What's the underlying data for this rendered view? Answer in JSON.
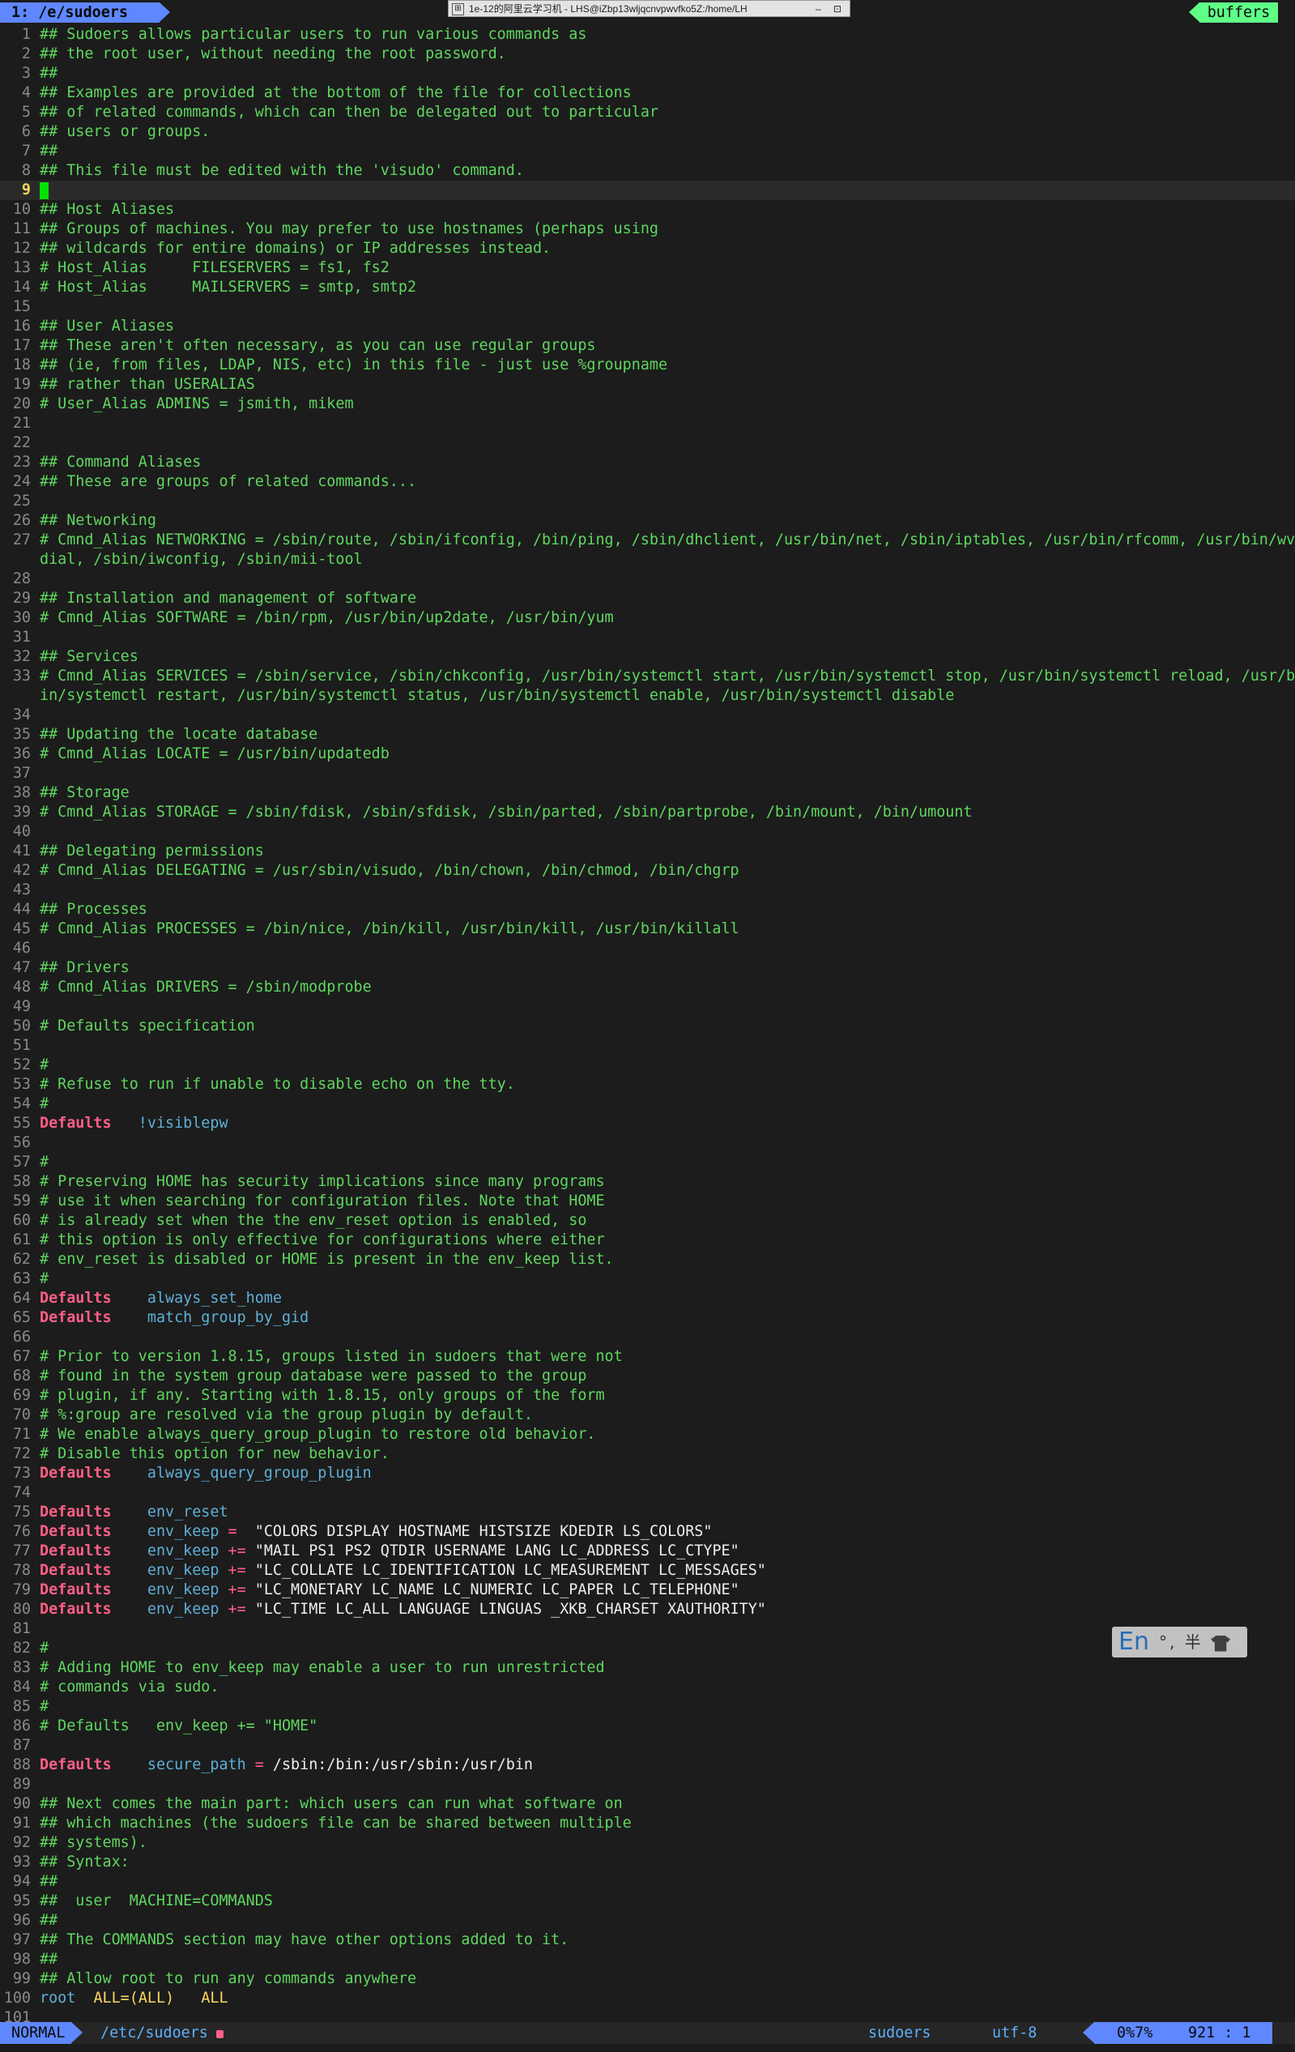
{
  "tabline": {
    "active_tab": "1: /e/sudoers",
    "buffers_label": "buffers"
  },
  "window_title": {
    "text": "1e-12的阿里云学习机 - LHS@iZbp13wljqcnvpwvfko5Z:/home/LH",
    "controls": "– ⊡"
  },
  "cursor_line": 9,
  "lines": [
    [
      {
        "c": "comment",
        "t": "## Sudoers allows particular users to run various commands as"
      }
    ],
    [
      {
        "c": "comment",
        "t": "## the root user, without needing the root password."
      }
    ],
    [
      {
        "c": "comment",
        "t": "##"
      }
    ],
    [
      {
        "c": "comment",
        "t": "## Examples are provided at the bottom of the file for collections"
      }
    ],
    [
      {
        "c": "comment",
        "t": "## of related commands, which can then be delegated out to particular"
      }
    ],
    [
      {
        "c": "comment",
        "t": "## users or groups."
      }
    ],
    [
      {
        "c": "comment",
        "t": "##"
      }
    ],
    [
      {
        "c": "comment",
        "t": "## This file must be edited with the 'visudo' command."
      }
    ],
    [],
    [
      {
        "c": "comment",
        "t": "## Host Aliases"
      }
    ],
    [
      {
        "c": "comment",
        "t": "## Groups of machines. You may prefer to use hostnames (perhaps using"
      }
    ],
    [
      {
        "c": "comment",
        "t": "## wildcards for entire domains) or IP addresses instead."
      }
    ],
    [
      {
        "c": "comment",
        "t": "# Host_Alias     FILESERVERS = fs1, fs2"
      }
    ],
    [
      {
        "c": "comment",
        "t": "# Host_Alias     MAILSERVERS = smtp, smtp2"
      }
    ],
    [],
    [
      {
        "c": "comment",
        "t": "## User Aliases"
      }
    ],
    [
      {
        "c": "comment",
        "t": "## These aren't often necessary, as you can use regular groups"
      }
    ],
    [
      {
        "c": "comment",
        "t": "## (ie, from files, LDAP, NIS, etc) in this file - just use %groupname"
      }
    ],
    [
      {
        "c": "comment",
        "t": "## rather than USERALIAS"
      }
    ],
    [
      {
        "c": "comment",
        "t": "# User_Alias ADMINS = jsmith, mikem"
      }
    ],
    [],
    [],
    [
      {
        "c": "comment",
        "t": "## Command Aliases"
      }
    ],
    [
      {
        "c": "comment",
        "t": "## These are groups of related commands..."
      }
    ],
    [],
    [
      {
        "c": "comment",
        "t": "## Networking"
      }
    ],
    [
      {
        "c": "comment",
        "t": "# Cmnd_Alias NETWORKING = /sbin/route, /sbin/ifconfig, /bin/ping, /sbin/dhclient, /usr/bin/net, /sbin/iptables, /usr/bin/rfcomm, /usr/bin/wv"
      }
    ],
    [
      {
        "c": "comment",
        "t": "dial, /sbin/iwconfig, /sbin/mii-tool"
      }
    ],
    [],
    [
      {
        "c": "comment",
        "t": "## Installation and management of software"
      }
    ],
    [
      {
        "c": "comment",
        "t": "# Cmnd_Alias SOFTWARE = /bin/rpm, /usr/bin/up2date, /usr/bin/yum"
      }
    ],
    [],
    [
      {
        "c": "comment",
        "t": "## Services"
      }
    ],
    [
      {
        "c": "comment",
        "t": "# Cmnd_Alias SERVICES = /sbin/service, /sbin/chkconfig, /usr/bin/systemctl start, /usr/bin/systemctl stop, /usr/bin/systemctl reload, /usr/b"
      }
    ],
    [
      {
        "c": "comment",
        "t": "in/systemctl restart, /usr/bin/systemctl status, /usr/bin/systemctl enable, /usr/bin/systemctl disable"
      }
    ],
    [],
    [
      {
        "c": "comment",
        "t": "## Updating the locate database"
      }
    ],
    [
      {
        "c": "comment",
        "t": "# Cmnd_Alias LOCATE = /usr/bin/updatedb"
      }
    ],
    [],
    [
      {
        "c": "comment",
        "t": "## Storage"
      }
    ],
    [
      {
        "c": "comment",
        "t": "# Cmnd_Alias STORAGE = /sbin/fdisk, /sbin/sfdisk, /sbin/parted, /sbin/partprobe, /bin/mount, /bin/umount"
      }
    ],
    [],
    [
      {
        "c": "comment",
        "t": "## Delegating permissions"
      }
    ],
    [
      {
        "c": "comment",
        "t": "# Cmnd_Alias DELEGATING = /usr/sbin/visudo, /bin/chown, /bin/chmod, /bin/chgrp"
      }
    ],
    [],
    [
      {
        "c": "comment",
        "t": "## Processes"
      }
    ],
    [
      {
        "c": "comment",
        "t": "# Cmnd_Alias PROCESSES = /bin/nice, /bin/kill, /usr/bin/kill, /usr/bin/killall"
      }
    ],
    [],
    [
      {
        "c": "comment",
        "t": "## Drivers"
      }
    ],
    [
      {
        "c": "comment",
        "t": "# Cmnd_Alias DRIVERS = /sbin/modprobe"
      }
    ],
    [],
    [
      {
        "c": "comment",
        "t": "# Defaults specification"
      }
    ],
    [],
    [
      {
        "c": "comment",
        "t": "#"
      }
    ],
    [
      {
        "c": "comment",
        "t": "# Refuse to run if unable to disable echo on the tty."
      }
    ],
    [
      {
        "c": "comment",
        "t": "#"
      }
    ],
    [
      {
        "c": "kw",
        "t": "Defaults"
      },
      {
        "c": "plain",
        "t": "   "
      },
      {
        "c": "ident",
        "t": "!visiblepw"
      }
    ],
    [],
    [
      {
        "c": "comment",
        "t": "#"
      }
    ],
    [
      {
        "c": "comment",
        "t": "# Preserving HOME has security implications since many programs"
      }
    ],
    [
      {
        "c": "comment",
        "t": "# use it when searching for configuration files. Note that HOME"
      }
    ],
    [
      {
        "c": "comment",
        "t": "# is already set when the the env_reset option is enabled, so"
      }
    ],
    [
      {
        "c": "comment",
        "t": "# this option is only effective for configurations where either"
      }
    ],
    [
      {
        "c": "comment",
        "t": "# env_reset is disabled or HOME is present in the env_keep list."
      }
    ],
    [
      {
        "c": "comment",
        "t": "#"
      }
    ],
    [
      {
        "c": "kw",
        "t": "Defaults"
      },
      {
        "c": "plain",
        "t": "    "
      },
      {
        "c": "ident",
        "t": "always_set_home"
      }
    ],
    [
      {
        "c": "kw",
        "t": "Defaults"
      },
      {
        "c": "plain",
        "t": "    "
      },
      {
        "c": "ident",
        "t": "match_group_by_gid"
      }
    ],
    [],
    [
      {
        "c": "comment",
        "t": "# Prior to version 1.8.15, groups listed in sudoers that were not"
      }
    ],
    [
      {
        "c": "comment",
        "t": "# found in the system group database were passed to the group"
      }
    ],
    [
      {
        "c": "comment",
        "t": "# plugin, if any. Starting with 1.8.15, only groups of the form"
      }
    ],
    [
      {
        "c": "comment",
        "t": "# %:group are resolved via the group plugin by default."
      }
    ],
    [
      {
        "c": "comment",
        "t": "# We enable always_query_group_plugin to restore old behavior."
      }
    ],
    [
      {
        "c": "comment",
        "t": "# Disable this option for new behavior."
      }
    ],
    [
      {
        "c": "kw",
        "t": "Defaults"
      },
      {
        "c": "plain",
        "t": "    "
      },
      {
        "c": "ident",
        "t": "always_query_group_plugin"
      }
    ],
    [],
    [
      {
        "c": "kw",
        "t": "Defaults"
      },
      {
        "c": "plain",
        "t": "    "
      },
      {
        "c": "ident",
        "t": "env_reset"
      }
    ],
    [
      {
        "c": "kw",
        "t": "Defaults"
      },
      {
        "c": "plain",
        "t": "    "
      },
      {
        "c": "ident",
        "t": "env_keep"
      },
      {
        "c": "plain",
        "t": " "
      },
      {
        "c": "op",
        "t": "="
      },
      {
        "c": "plain",
        "t": "  "
      },
      {
        "c": "str",
        "t": "\"COLORS DISPLAY HOSTNAME HISTSIZE KDEDIR LS_COLORS\""
      }
    ],
    [
      {
        "c": "kw",
        "t": "Defaults"
      },
      {
        "c": "plain",
        "t": "    "
      },
      {
        "c": "ident",
        "t": "env_keep"
      },
      {
        "c": "plain",
        "t": " "
      },
      {
        "c": "op",
        "t": "+="
      },
      {
        "c": "plain",
        "t": " "
      },
      {
        "c": "str",
        "t": "\"MAIL PS1 PS2 QTDIR USERNAME LANG LC_ADDRESS LC_CTYPE\""
      }
    ],
    [
      {
        "c": "kw",
        "t": "Defaults"
      },
      {
        "c": "plain",
        "t": "    "
      },
      {
        "c": "ident",
        "t": "env_keep"
      },
      {
        "c": "plain",
        "t": " "
      },
      {
        "c": "op",
        "t": "+="
      },
      {
        "c": "plain",
        "t": " "
      },
      {
        "c": "str",
        "t": "\"LC_COLLATE LC_IDENTIFICATION LC_MEASUREMENT LC_MESSAGES\""
      }
    ],
    [
      {
        "c": "kw",
        "t": "Defaults"
      },
      {
        "c": "plain",
        "t": "    "
      },
      {
        "c": "ident",
        "t": "env_keep"
      },
      {
        "c": "plain",
        "t": " "
      },
      {
        "c": "op",
        "t": "+="
      },
      {
        "c": "plain",
        "t": " "
      },
      {
        "c": "str",
        "t": "\"LC_MONETARY LC_NAME LC_NUMERIC LC_PAPER LC_TELEPHONE\""
      }
    ],
    [
      {
        "c": "kw",
        "t": "Defaults"
      },
      {
        "c": "plain",
        "t": "    "
      },
      {
        "c": "ident",
        "t": "env_keep"
      },
      {
        "c": "plain",
        "t": " "
      },
      {
        "c": "op",
        "t": "+="
      },
      {
        "c": "plain",
        "t": " "
      },
      {
        "c": "str",
        "t": "\"LC_TIME LC_ALL LANGUAGE LINGUAS _XKB_CHARSET XAUTHORITY\""
      }
    ],
    [],
    [
      {
        "c": "comment",
        "t": "#"
      }
    ],
    [
      {
        "c": "comment",
        "t": "# Adding HOME to env_keep may enable a user to run unrestricted"
      }
    ],
    [
      {
        "c": "comment",
        "t": "# commands via sudo."
      }
    ],
    [
      {
        "c": "comment",
        "t": "#"
      }
    ],
    [
      {
        "c": "comment",
        "t": "# Defaults   env_keep += \"HOME\""
      }
    ],
    [],
    [
      {
        "c": "kw",
        "t": "Defaults"
      },
      {
        "c": "plain",
        "t": "    "
      },
      {
        "c": "ident",
        "t": "secure_path"
      },
      {
        "c": "plain",
        "t": " "
      },
      {
        "c": "op",
        "t": "="
      },
      {
        "c": "plain",
        "t": " "
      },
      {
        "c": "str",
        "t": "/sbin:/bin:/usr/sbin:/usr/bin"
      }
    ],
    [],
    [
      {
        "c": "comment",
        "t": "## Next comes the main part: which users can run what software on"
      }
    ],
    [
      {
        "c": "comment",
        "t": "## which machines (the sudoers file can be shared between multiple"
      }
    ],
    [
      {
        "c": "comment",
        "t": "## systems)."
      }
    ],
    [
      {
        "c": "comment",
        "t": "## Syntax:"
      }
    ],
    [
      {
        "c": "comment",
        "t": "##"
      }
    ],
    [
      {
        "c": "comment",
        "t": "##  user  MACHINE=COMMANDS"
      }
    ],
    [
      {
        "c": "comment",
        "t": "##"
      }
    ],
    [
      {
        "c": "comment",
        "t": "## The COMMANDS section may have other options added to it."
      }
    ],
    [
      {
        "c": "comment",
        "t": "##"
      }
    ],
    [
      {
        "c": "comment",
        "t": "## Allow root to run any commands anywhere"
      }
    ],
    [
      {
        "c": "user",
        "t": "root"
      },
      {
        "c": "plain",
        "t": "  "
      },
      {
        "c": "val",
        "t": "ALL=(ALL)"
      },
      {
        "c": "plain",
        "t": "   "
      },
      {
        "c": "val",
        "t": "ALL"
      }
    ],
    []
  ],
  "line_numbers": [
    "1",
    "2",
    "3",
    "4",
    "5",
    "6",
    "7",
    "8",
    "9",
    "10",
    "11",
    "12",
    "13",
    "14",
    "15",
    "16",
    "17",
    "18",
    "19",
    "20",
    "21",
    "22",
    "23",
    "24",
    "25",
    "26",
    "27",
    "",
    "28",
    "29",
    "30",
    "31",
    "32",
    "33",
    "",
    "34",
    "35",
    "36",
    "37",
    "38",
    "39",
    "40",
    "41",
    "42",
    "43",
    "44",
    "45",
    "46",
    "47",
    "48",
    "49",
    "50",
    "51",
    "52",
    "53",
    "54",
    "55",
    "56",
    "57",
    "58",
    "59",
    "60",
    "61",
    "62",
    "63",
    "64",
    "65",
    "66",
    "67",
    "68",
    "69",
    "70",
    "71",
    "72",
    "73",
    "74",
    "75",
    "76",
    "77",
    "78",
    "79",
    "80",
    "81",
    "82",
    "83",
    "84",
    "85",
    "86",
    "87",
    "88",
    "89",
    "90",
    "91",
    "92",
    "93",
    "94",
    "95",
    "96",
    "97",
    "98",
    "99",
    "100",
    "101"
  ],
  "statusline": {
    "mode": "NORMAL",
    "path": "/etc/sudoers",
    "filetype": "sudoers",
    "encoding": "utf-8",
    "percent": "0%7%",
    "position": "921 :  1"
  },
  "ime": {
    "lang": "En",
    "rest": "°, 半"
  },
  "colors": {
    "background": "#1c1c1c",
    "comment": "#5fd75f",
    "keyword": "#ff5f87",
    "identifier": "#5fafd7",
    "accent": "#5f87ff",
    "buffers": "#5fff87"
  }
}
